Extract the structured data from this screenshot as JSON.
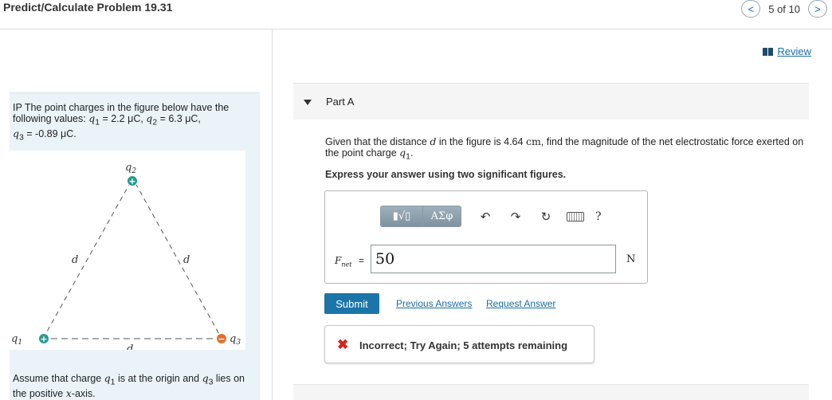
{
  "header": {
    "title": "Predict/Calculate Problem 19.31",
    "prev_icon": "chevron-left-icon",
    "next_icon": "chevron-right-icon",
    "prev_glyph": "<",
    "next_glyph": ">",
    "position": "5 of 10"
  },
  "review": {
    "label": "Review",
    "icon": "book-icon"
  },
  "problem": {
    "intro": "IP The point charges in the figure below have the following values:",
    "q1": "q",
    "q1_sub": "1",
    "q1_value": " = 2.2 μC, ",
    "q2_sub": "2",
    "q2_value": " = 6.3 μC,",
    "q3_sub": "3",
    "q3_value": " = -0.89 μC.",
    "footnote_a": "Assume that charge ",
    "footnote_b": " is at the origin and ",
    "footnote_c": " lies on the positive ",
    "footnote_axis": "x",
    "footnote_d": "-axis."
  },
  "figure": {
    "q1_label": "q",
    "q1_sub": "1",
    "q2_label": "q",
    "q2_sub": "2",
    "q3_label": "q",
    "q3_sub": "3",
    "side_label": "d",
    "plus_glyph": "+",
    "minus_glyph": "−",
    "positive_color": "#2a9a8e",
    "negative_color": "#e2702d"
  },
  "part": {
    "title": "Part A",
    "icon": "caret-down-icon"
  },
  "question": {
    "text_a": "Given that the distance ",
    "d": "d",
    "text_b": " in the figure is 4.64 ",
    "unit_cm": "cm",
    "text_c": ", find the magnitude of the net electrostatic force exerted on the point charge ",
    "q": "q",
    "q_sub": "1",
    "text_d": "."
  },
  "instruction": "Express your answer using two significant figures.",
  "toolbar": {
    "templates_glyph": "▮√▯",
    "greek_label": "ΑΣφ",
    "undo_glyph": "↶",
    "redo_glyph": "↷",
    "reset_glyph": "↻",
    "help_glyph": "?"
  },
  "answer": {
    "label": "F",
    "label_sub": "net",
    "equals": "=",
    "value": "50",
    "unit": "N"
  },
  "actions": {
    "submit_label": "Submit",
    "previous_answers_label": "Previous Answers",
    "request_answer_label": "Request Answer"
  },
  "feedback": {
    "icon": "x-icon",
    "glyph": "✖",
    "text": "Incorrect; Try Again; 5 attempts remaining",
    "color": "#d8231c"
  }
}
